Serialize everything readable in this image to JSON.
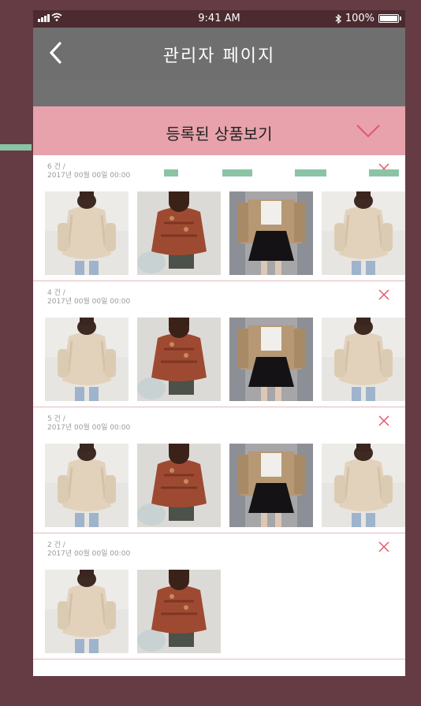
{
  "status_bar": {
    "time": "9:41 AM",
    "battery": "100%"
  },
  "nav": {
    "title": "관리자  페이지"
  },
  "panel": {
    "title": "등록된 상품보기"
  },
  "sections": [
    {
      "count": "6 건 /",
      "date": "2017년 00월 00일 00:00",
      "thumbs": [
        "cream",
        "red",
        "tan",
        "cream"
      ]
    },
    {
      "count": "4 건 /",
      "date": "2017년 00월 00일 00:00",
      "thumbs": [
        "cream",
        "red",
        "tan",
        "cream"
      ]
    },
    {
      "count": "5 건 /",
      "date": "2017년 00월 00일 00:00",
      "thumbs": [
        "cream",
        "red",
        "tan",
        "cream"
      ]
    },
    {
      "count": "2 건 /",
      "date": "2017년 00월 00일 00:00",
      "thumbs": [
        "cream",
        "red"
      ]
    }
  ],
  "colors": {
    "background": "#653c44",
    "panel_header": "#e7a2ac",
    "accent": "#e5566e",
    "annotation": "#8ac4a4"
  },
  "icons": [
    "back-chevron-icon",
    "chevron-down-icon",
    "close-icon",
    "wifi-icon",
    "bluetooth-icon",
    "battery-icon",
    "signal-icon"
  ]
}
